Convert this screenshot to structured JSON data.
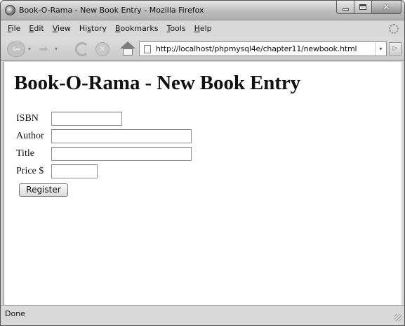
{
  "window": {
    "title": "Book-O-Rama - New Book Entry - Mozilla Firefox"
  },
  "menu": {
    "items": [
      {
        "accel": "F",
        "rest": "ile"
      },
      {
        "accel": "E",
        "rest": "dit"
      },
      {
        "accel": "V",
        "rest": "iew"
      },
      {
        "pre": "Hi",
        "accel": "s",
        "rest": "tory"
      },
      {
        "accel": "B",
        "rest": "ookmarks"
      },
      {
        "accel": "T",
        "rest": "ools"
      },
      {
        "accel": "H",
        "rest": "elp"
      }
    ]
  },
  "toolbar": {
    "url": "http://localhost/phpmysql4e/chapter11/newbook.html",
    "back_glyph": "⇦",
    "forward_glyph": "➡",
    "stop_glyph": "✕",
    "dropdown_glyph": "▾",
    "go_glyph": "▷"
  },
  "page": {
    "heading": "Book-O-Rama - New Book Entry",
    "fields": {
      "isbn": {
        "label": "ISBN",
        "value": ""
      },
      "author": {
        "label": "Author",
        "value": ""
      },
      "title": {
        "label": "Title",
        "value": ""
      },
      "price": {
        "label": "Price $",
        "value": ""
      }
    },
    "register_label": "Register"
  },
  "status": {
    "text": "Done"
  },
  "icons": {
    "app": "firefox-icon",
    "back": "back-arrow-icon",
    "forward": "forward-arrow-icon",
    "reload": "reload-icon",
    "stop": "stop-icon",
    "home": "home-icon",
    "page": "page-icon",
    "throbber": "throbber-icon"
  }
}
